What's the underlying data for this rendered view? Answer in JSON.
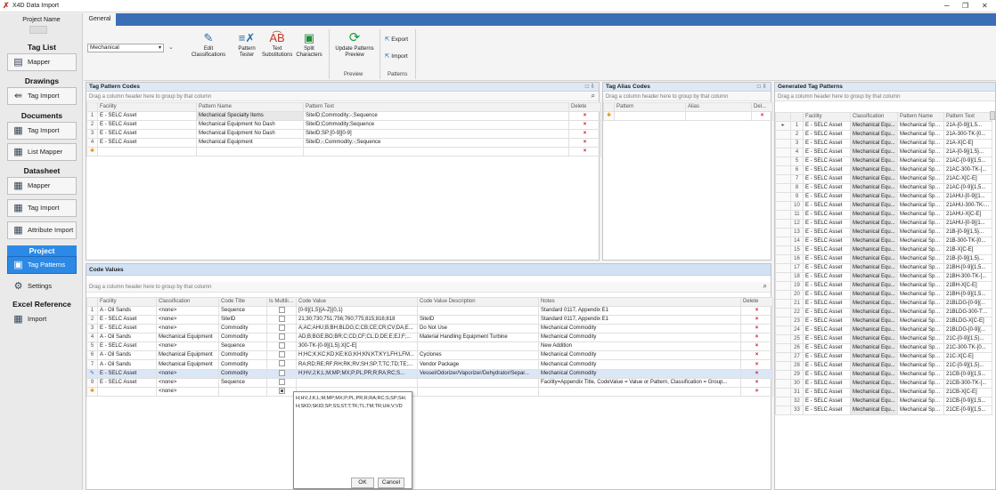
{
  "window": {
    "title": "X4D Data Import",
    "minimize": "–",
    "restore": "❐",
    "close": "✕"
  },
  "sidebar": {
    "project_name_label": "Project Name",
    "sections": [
      {
        "title": "Tag List",
        "items": [
          {
            "label": "Mapper",
            "icon": "mapper-icon"
          }
        ]
      },
      {
        "title": "Drawings",
        "items": [
          {
            "label": "Tag Import",
            "icon": "import-icon"
          }
        ]
      },
      {
        "title": "Documents",
        "items": [
          {
            "label": "Tag Import",
            "icon": "import-icon"
          },
          {
            "label": "List Mapper",
            "icon": "list-mapper-icon"
          }
        ]
      },
      {
        "title": "Datasheet",
        "items": [
          {
            "label": "Mapper",
            "icon": "grid-icon"
          },
          {
            "label": "Tag Import",
            "icon": "import-icon"
          },
          {
            "label": "Attribute Import",
            "icon": "attribute-import-icon"
          }
        ]
      },
      {
        "title": "Project",
        "items": [
          {
            "label": "Tag Patterns",
            "icon": "tag-patterns-icon"
          },
          {
            "label": "Settings",
            "icon": "gear-icon"
          }
        ]
      },
      {
        "title": "Excel Reference",
        "items": [
          {
            "label": "Import",
            "icon": "import-icon"
          }
        ]
      }
    ]
  },
  "tabs": {
    "general": "General"
  },
  "ribbon": {
    "facility_select": "Mechanical",
    "buttons": {
      "edit_classifications": "Edit Classifications",
      "pattern_tester": "Pattern Tester",
      "text_substitutions": "Text Substitutions",
      "split_characters": "Split Characters",
      "update_patterns_preview": "Update Patterns Preview",
      "export": "Export",
      "import": "Import"
    },
    "groups": {
      "preview": "Preview",
      "patterns": "Patterns"
    }
  },
  "tag_pattern_codes": {
    "title": "Tag Pattern Codes",
    "group_hint": "Drag a column header here to group by that column",
    "columns": [
      "Facility",
      "Pattern Name",
      "Pattern Text",
      "Delete"
    ],
    "rows": [
      {
        "num": "1",
        "facility": "E - SELC Asset",
        "name": "Mechanical Specialty Items",
        "text": "SiteID;Commodity;-;Sequence"
      },
      {
        "num": "2",
        "facility": "E - SELC Asset",
        "name": "Mechanical Equipment No Dash",
        "text": "SiteID;Commodity;Sequence"
      },
      {
        "num": "3",
        "facility": "E - SELC Asset",
        "name": "Mechanical Equipment No Dash",
        "text": "SiteID;SP;[0-9][0-9]"
      },
      {
        "num": "4",
        "facility": "E - SELC Asset",
        "name": "Mechanical Equipment",
        "text": "SiteID;-;Commodity;-;Sequence"
      }
    ]
  },
  "tag_alias_codes": {
    "title": "Tag Alias Codes",
    "group_hint": "Drag a column header here to group by that column",
    "columns": [
      "Pattern",
      "Alias",
      "Del..."
    ]
  },
  "generated_tag_patterns": {
    "title": "Generated Tag Patterns",
    "group_hint": "Drag a column header here to group by that column",
    "columns": [
      "Facility",
      "Classification",
      "Pattern Name",
      "Pattern Text"
    ],
    "rows": [
      [
        "1",
        "E - SELC Asset",
        "Mechanical Equ...",
        "Mechanical Spe...",
        "21A-[0-9]{1,5..."
      ],
      [
        "2",
        "E - SELC Asset",
        "Mechanical Equ...",
        "Mechanical Spe...",
        "21A-300-TK-[0..."
      ],
      [
        "3",
        "E - SELC Asset",
        "Mechanical Equ...",
        "Mechanical Spe...",
        "21A-X[C-E]"
      ],
      [
        "4",
        "E - SELC Asset",
        "Mechanical Equ...",
        "Mechanical Spe...",
        "21A-[0-9]{1,5}..."
      ],
      [
        "5",
        "E - SELC Asset",
        "Mechanical Equ...",
        "Mechanical Spe...",
        "21AC-[0-9]{1,5..."
      ],
      [
        "6",
        "E - SELC Asset",
        "Mechanical Equ...",
        "Mechanical Spe...",
        "21AC-300-TK-[..."
      ],
      [
        "7",
        "E - SELC Asset",
        "Mechanical Equ...",
        "Mechanical Spe...",
        "21AC-X[C-E]"
      ],
      [
        "8",
        "E - SELC Asset",
        "Mechanical Equ...",
        "Mechanical Spe...",
        "21AC-[0-9]{1,5..."
      ],
      [
        "9",
        "E - SELC Asset",
        "Mechanical Equ...",
        "Mechanical Spe...",
        "21AHU-[0-9]{1..."
      ],
      [
        "10",
        "E - SELC Asset",
        "Mechanical Equ...",
        "Mechanical Spe...",
        "21AHU-300-TK-..."
      ],
      [
        "11",
        "E - SELC Asset",
        "Mechanical Equ...",
        "Mechanical Spe...",
        "21AHU-X[C-E]"
      ],
      [
        "12",
        "E - SELC Asset",
        "Mechanical Equ...",
        "Mechanical Spe...",
        "21AHU-[0-9]{1..."
      ],
      [
        "13",
        "E - SELC Asset",
        "Mechanical Equ...",
        "Mechanical Spe...",
        "21B-[0-9]{1,5}..."
      ],
      [
        "14",
        "E - SELC Asset",
        "Mechanical Equ...",
        "Mechanical Spe...",
        "21B-300-TK-[0..."
      ],
      [
        "15",
        "E - SELC Asset",
        "Mechanical Equ...",
        "Mechanical Spe...",
        "21B-X[C-E]"
      ],
      [
        "16",
        "E - SELC Asset",
        "Mechanical Equ...",
        "Mechanical Spe...",
        "21B-[0-9]{1,5}..."
      ],
      [
        "17",
        "E - SELC Asset",
        "Mechanical Equ...",
        "Mechanical Spe...",
        "21BH-[0-9]{1,5..."
      ],
      [
        "18",
        "E - SELC Asset",
        "Mechanical Equ...",
        "Mechanical Spe...",
        "21BH-300-TK-[..."
      ],
      [
        "19",
        "E - SELC Asset",
        "Mechanical Equ...",
        "Mechanical Spe...",
        "21BH-X[C-E]"
      ],
      [
        "20",
        "E - SELC Asset",
        "Mechanical Equ...",
        "Mechanical Spe...",
        "21BH-[0-9]{1,5..."
      ],
      [
        "21",
        "E - SELC Asset",
        "Mechanical Equ...",
        "Mechanical Spe...",
        "21BLDG-[0-9]{..."
      ],
      [
        "22",
        "E - SELC Asset",
        "Mechanical Equ...",
        "Mechanical Spe...",
        "21BLDG-300-TK..."
      ],
      [
        "23",
        "E - SELC Asset",
        "Mechanical Equ...",
        "Mechanical Spe...",
        "21BLDG-X[C-E]"
      ],
      [
        "24",
        "E - SELC Asset",
        "Mechanical Equ...",
        "Mechanical Spe...",
        "21BLDG-[0-9]{..."
      ],
      [
        "25",
        "E - SELC Asset",
        "Mechanical Equ...",
        "Mechanical Spe...",
        "21C-[0-9]{1,5}..."
      ],
      [
        "26",
        "E - SELC Asset",
        "Mechanical Equ...",
        "Mechanical Spe...",
        "21C-300-TK-[0..."
      ],
      [
        "27",
        "E - SELC Asset",
        "Mechanical Equ...",
        "Mechanical Spe...",
        "21C-X[C-E]"
      ],
      [
        "28",
        "E - SELC Asset",
        "Mechanical Equ...",
        "Mechanical Spe...",
        "21C-[0-9]{1,5}..."
      ],
      [
        "29",
        "E - SELC Asset",
        "Mechanical Equ...",
        "Mechanical Spe...",
        "21CB-[0-9]{1,5..."
      ],
      [
        "30",
        "E - SELC Asset",
        "Mechanical Equ...",
        "Mechanical Spe...",
        "21CB-300-TK-[..."
      ],
      [
        "31",
        "E - SELC Asset",
        "Mechanical Equ...",
        "Mechanical Spe...",
        "21CB-X[C-E]"
      ],
      [
        "32",
        "E - SELC Asset",
        "Mechanical Equ...",
        "Mechanical Spe...",
        "21CB-[0-9]{1,5..."
      ],
      [
        "33",
        "E - SELC Asset",
        "Mechanical Equ...",
        "Mechanical Spe...",
        "21CE-[0-9]{1,5..."
      ]
    ]
  },
  "code_values": {
    "title": "Code Values",
    "group_hint": "Drag a column header here to group by that column",
    "columns": [
      "Facility",
      "Classification",
      "Code Title",
      "Is Multiline",
      "Code Value",
      "Code Value Description",
      "Notes",
      "Delete"
    ],
    "rows": [
      {
        "num": "1",
        "facility": "A - Oil Sands",
        "cls": "<none>",
        "title": "Sequence",
        "multi": false,
        "value": "[0-9]{1,5}[A-Z]{0,1}",
        "desc": "",
        "notes": "Standard 0117, Appendix E1"
      },
      {
        "num": "2",
        "facility": "E - SELC Asset",
        "cls": "<none>",
        "title": "SiteID",
        "multi": false,
        "value": "21;30;730;751;756;760;775;815;816;818",
        "desc": "SiteID",
        "notes": "Standard 0117, Appendix E1"
      },
      {
        "num": "3",
        "facility": "E - SELC Asset",
        "cls": "<none>",
        "title": "Commodity",
        "multi": false,
        "value": "A;AC;AHU;B;BH;BLDG;C;CB;CE;CR;CV;DA;E...",
        "desc": "Do Not Use",
        "notes": "Mechanical Commodity"
      },
      {
        "num": "4",
        "facility": "A - Oil Sands",
        "cls": "Mechanical Equipment",
        "title": "Commodity",
        "multi": false,
        "value": "AD;B;BGE;BO;BR;C;CD;CF;CL;D;DE;E;EJ;F;...",
        "desc": "Material Handling Equipment Turbine",
        "notes": "Mechanical Commodity"
      },
      {
        "num": "5",
        "facility": "E - SELC Asset",
        "cls": "<none>",
        "title": "Sequence",
        "multi": false,
        "value": "300-TK-[0-9]{1,5};X[C-E]",
        "desc": "",
        "notes": "New Addition"
      },
      {
        "num": "6",
        "facility": "A - Oil Sands",
        "cls": "Mechanical Equipment",
        "title": "Commodity",
        "multi": false,
        "value": "H;HC;K;KC;KD;KE;KG;KH;KN;KT;KY;LFH;LFM...",
        "desc": "Cyclones",
        "notes": "Mechanical Commodity"
      },
      {
        "num": "7",
        "facility": "A - Oil Sands",
        "cls": "Mechanical Equipment",
        "title": "Commodity",
        "multi": false,
        "value": "RA;RD;RE;RF;RH;RK;RV;SH;SP;T;TC;TD;TE;...",
        "desc": "Vendor Package",
        "notes": "Mechanical Commodity"
      },
      {
        "num": "8",
        "facility": "E - SELC Asset",
        "cls": "<none>",
        "title": "Commodity",
        "multi": false,
        "value": "H;HV;J;K;L;M;MP;MX;P;PL;PR;R;RA;RC;S...",
        "desc": "Vessel/Odorizer/Vaporizer/Dehydrator/Separ...",
        "notes": "Mechanical Commodity"
      },
      {
        "num": "9",
        "facility": "E - SELC Asset",
        "cls": "<none>",
        "title": "Sequence",
        "multi": false,
        "value": "",
        "desc": "",
        "notes": "Facility=Appendix Title, CodeValue = Value or Pattern, Classification = Group..."
      },
      {
        "num": "",
        "facility": "",
        "cls": "<none>",
        "title": "",
        "multi": true,
        "value": "",
        "desc": "",
        "notes": ""
      }
    ]
  },
  "popup": {
    "lines": [
      "H;HV;J;K;L;M;MP;MX;P;PL;PR;R;RA;RC;S;SP;SH;",
      "H;SKD;SKID;SP;SS;ST;T;TK;TL;TM;TR;UH;V;VD"
    ],
    "ok": "OK",
    "cancel": "Cancel"
  }
}
